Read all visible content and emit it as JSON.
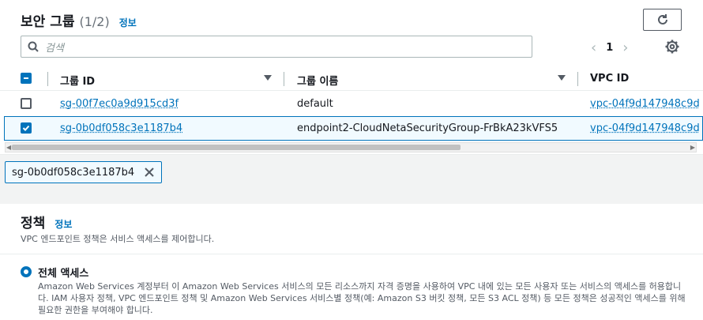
{
  "header": {
    "title": "보안 그룹",
    "count": "(1/2)",
    "info": "정보"
  },
  "search": {
    "placeholder": "검색"
  },
  "pagination": {
    "current": "1"
  },
  "table": {
    "columns": [
      "그룹 ID",
      "그룹 이름",
      "VPC ID"
    ],
    "rows": [
      {
        "group_id": "sg-00f7ec0a9d915cd3f",
        "group_name": "default",
        "vpc_id": "vpc-04f9d147948c9d",
        "selected": false
      },
      {
        "group_id": "sg-0b0df058c3e1187b4",
        "group_name": "endpoint2-CloudNetaSecurityGroup-FrBkA23kVFS5",
        "vpc_id": "vpc-04f9d147948c9d",
        "selected": true
      }
    ]
  },
  "selected_token": {
    "label": "sg-0b0df058c3e1187b4"
  },
  "policy": {
    "title": "정책",
    "info": "정보",
    "description": "VPC 엔드포인트 정책은 서비스 액세스를 제어합니다.",
    "option_title": "전체 액세스",
    "option_desc": "Amazon Web Services 계정부터 이 Amazon Web Services 서비스의 모든 리소스까지 자격 증명을 사용하여 VPC 내에 있는 모든 사용자 또는 서비스의 액세스를 허용합니다. IAM 사용자 정책, VPC 엔드포인트 정책 및 Amazon Web Services 서비스별 정책(예: Amazon S3 버킷 정책, 모든 S3 ACL 정책) 등 모든 정책은 성공적인 액세스를 위해 필요한 권한을 부여해야 합니다."
  },
  "colors": {
    "accent": "#0073bb",
    "text": "#16191f",
    "muted": "#687078"
  },
  "icons": [
    "refresh-icon",
    "search-icon",
    "chevron-left-icon",
    "chevron-right-icon",
    "gear-icon",
    "caret-down-icon",
    "close-icon",
    "check-icon",
    "minus-icon"
  ]
}
